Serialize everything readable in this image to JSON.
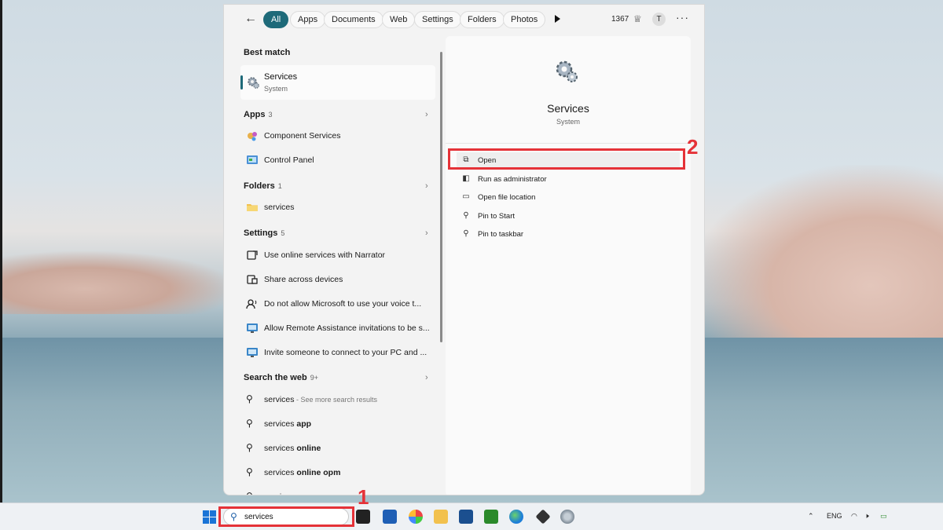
{
  "filters": {
    "chips": [
      "All",
      "Apps",
      "Documents",
      "Web",
      "Settings",
      "Folders",
      "Photos"
    ],
    "points": "1367",
    "avatar_letter": "T"
  },
  "best_match": {
    "heading": "Best match",
    "name": "Services",
    "type": "System"
  },
  "apps": {
    "heading": "Apps",
    "count": "3",
    "items": [
      "Component Services",
      "Control Panel"
    ]
  },
  "folders": {
    "heading": "Folders",
    "count": "1",
    "items": [
      "services"
    ]
  },
  "settings": {
    "heading": "Settings",
    "count": "5",
    "items": [
      "Use online services with Narrator",
      "Share across devices",
      "Do not allow Microsoft to use your voice t...",
      "Allow Remote Assistance invitations to be s...",
      "Invite someone to connect to your PC and ..."
    ]
  },
  "web": {
    "heading": "Search the web",
    "count": "9+",
    "first_query": "services",
    "first_hint": " - See more search results",
    "suggestions": [
      {
        "prefix": "services",
        "suffix": " app"
      },
      {
        "prefix": "services",
        "suffix": " online"
      },
      {
        "prefix": "services",
        "suffix": " online opm"
      },
      {
        "prefix": "services",
        "suffix": " manager"
      }
    ]
  },
  "detail": {
    "title": "Services",
    "subtitle": "System",
    "actions": [
      "Open",
      "Run as administrator",
      "Open file location",
      "Pin to Start",
      "Pin to taskbar"
    ]
  },
  "taskbar": {
    "search_value": "services",
    "language": "ENG"
  },
  "annotations": [
    "1",
    "2"
  ],
  "colors": {
    "accent": "#1e6a79",
    "annotation": "#e53238"
  }
}
